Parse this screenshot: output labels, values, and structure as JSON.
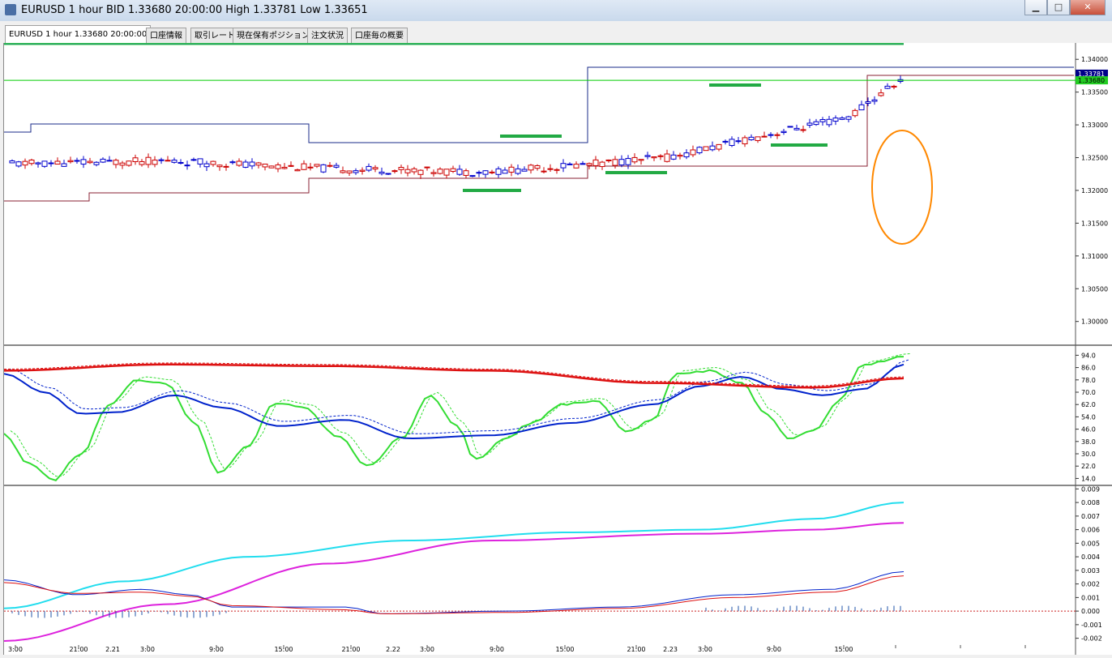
{
  "window": {
    "title": "EURUSD 1 hour BID 1.33680 20:00:00 High 1.33781 Low 1.33651",
    "minimize": "▁",
    "maximize": "□",
    "close": "✕",
    "icon": "chart-app-icon"
  },
  "tabs": [
    {
      "label": "EURUSD 1 hour 1.33680 20:00:00"
    },
    {
      "label": "口座情報"
    },
    {
      "label": "取引レート"
    },
    {
      "label": "現在保有ポジション"
    },
    {
      "label": "注文状況"
    },
    {
      "label": "口座毎の概要"
    }
  ],
  "chart_data": [
    {
      "type": "line",
      "panel": "price",
      "symbol": "EURUSD",
      "timeframe": "1 hour",
      "y_ticks": [
        "1.34000",
        "1.33500",
        "1.33000",
        "1.32500",
        "1.32000",
        "1.31500",
        "1.31000",
        "1.30500",
        "1.30000"
      ],
      "ylim": [
        1.2965,
        1.3425
      ],
      "current_price_labels": [
        "1.33781",
        "1.33680"
      ],
      "current_price_values": [
        1.33781,
        1.3368
      ],
      "colors": {
        "candle_up": "#0000cc",
        "candle_down": "#cc0000",
        "ma_fast": "#33dd33",
        "ma_mid": "#0022cc",
        "ma_slow": "#dd1111",
        "ma_long": "#22ddee",
        "orange_line": "#ff8800",
        "bands": "#660066",
        "price_line": "#00cc00",
        "annotation": "#ff8800",
        "level_marks": "#22aa44"
      },
      "annotation": "circle"
    },
    {
      "type": "line",
      "panel": "stochastic",
      "y_ticks": [
        "94.0",
        "86.0",
        "78.0",
        "70.0",
        "62.0",
        "54.0",
        "46.0",
        "38.0",
        "30.0",
        "22.0",
        "14.0"
      ],
      "ylim": [
        10,
        100
      ],
      "series_colors": [
        "#33dd33",
        "#0022cc",
        "#dd1111"
      ]
    },
    {
      "type": "line",
      "panel": "macd",
      "y_ticks": [
        "0.009",
        "0.008",
        "0.007",
        "0.006",
        "0.005",
        "0.004",
        "0.003",
        "0.002",
        "0.001",
        "0.000",
        "-0.001",
        "-0.002"
      ],
      "ylim": [
        -0.0025,
        0.0092
      ],
      "series_colors": [
        "#22ddee",
        "#dd22dd",
        "#0022cc",
        "#dd1111"
      ]
    }
  ],
  "x_labels": [
    "3:00",
    "21:00",
    "2.21",
    "3:00",
    "9:00",
    "15:00",
    "21:00",
    "2.22",
    "3:00",
    "9:00",
    "15:00",
    "21:00",
    "2.23",
    "3:00",
    "9:00",
    "15:00"
  ]
}
